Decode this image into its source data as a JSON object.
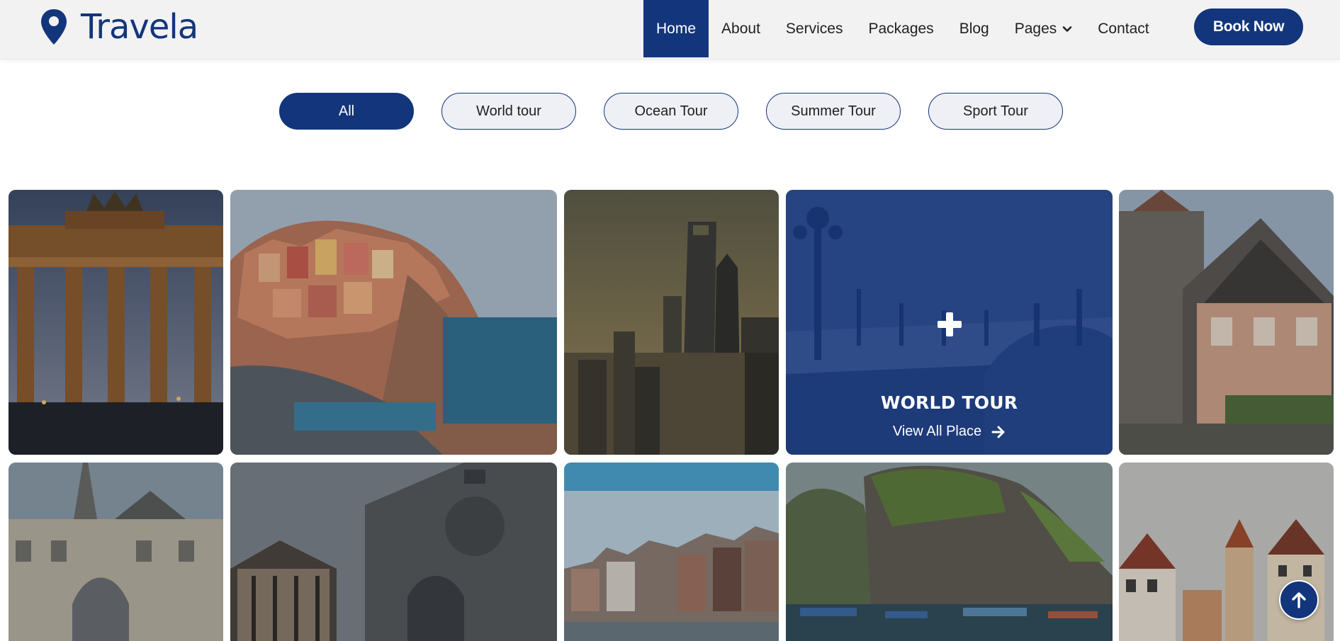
{
  "brand": {
    "name": "Travela",
    "icon": "map-pin-icon",
    "color": "#13357b"
  },
  "nav": {
    "items": [
      {
        "label": "Home",
        "active": true
      },
      {
        "label": "About"
      },
      {
        "label": "Services"
      },
      {
        "label": "Packages"
      },
      {
        "label": "Blog"
      },
      {
        "label": "Pages",
        "dropdown": true
      },
      {
        "label": "Contact"
      }
    ],
    "cta_label": "Book Now"
  },
  "filters": [
    {
      "label": "All",
      "active": true
    },
    {
      "label": "World tour"
    },
    {
      "label": "Ocean Tour"
    },
    {
      "label": "Summer Tour"
    },
    {
      "label": "Sport Tour"
    }
  ],
  "gallery": {
    "hover_overlay": {
      "icon": "plus-icon",
      "title": "WORLD TOUR",
      "link_label": "View All Place",
      "link_icon": "arrow-right-icon"
    }
  },
  "back_to_top": {
    "icon": "arrow-up-icon"
  },
  "colors": {
    "primary": "#13357b",
    "navbar_bg": "#f2f2f2"
  }
}
